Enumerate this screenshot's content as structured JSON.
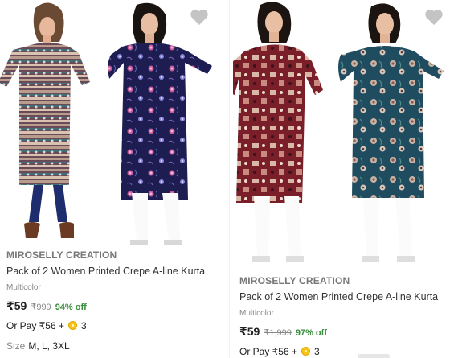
{
  "products": [
    {
      "brand": "MIROSELLY CREATION",
      "title": "Pack of 2 Women Printed Crepe A-line Kurta",
      "color": "Multicolor",
      "price": "₹59",
      "mrp": "₹999",
      "discount": "94% off",
      "or_pay_text": "Or Pay ₹56 +",
      "coins": "3",
      "sizes_label": "Size",
      "sizes": "M, L, 3XL",
      "wishlist_icon": "heart-icon",
      "kurta_colors": [
        "#6a4a58",
        "#1d1d52"
      ]
    },
    {
      "brand": "MIROSELLY CREATION",
      "title": "Pack of 2 Women Printed Crepe A-line Kurta",
      "color": "Multicolor",
      "price": "₹59",
      "mrp": "₹1,999",
      "discount": "97% off",
      "or_pay_text": "Or Pay ₹56 +",
      "coins": "3",
      "wishlist_icon": "heart-icon",
      "kurta_colors": [
        "#7a1f2a",
        "#1f4c5e"
      ]
    }
  ],
  "colors": {
    "price_text": "#212121",
    "muted_text": "#878787",
    "discount_green": "#388e3c",
    "wishlist_gray": "#c4c4c4",
    "coin_gold": "#f7c417"
  }
}
